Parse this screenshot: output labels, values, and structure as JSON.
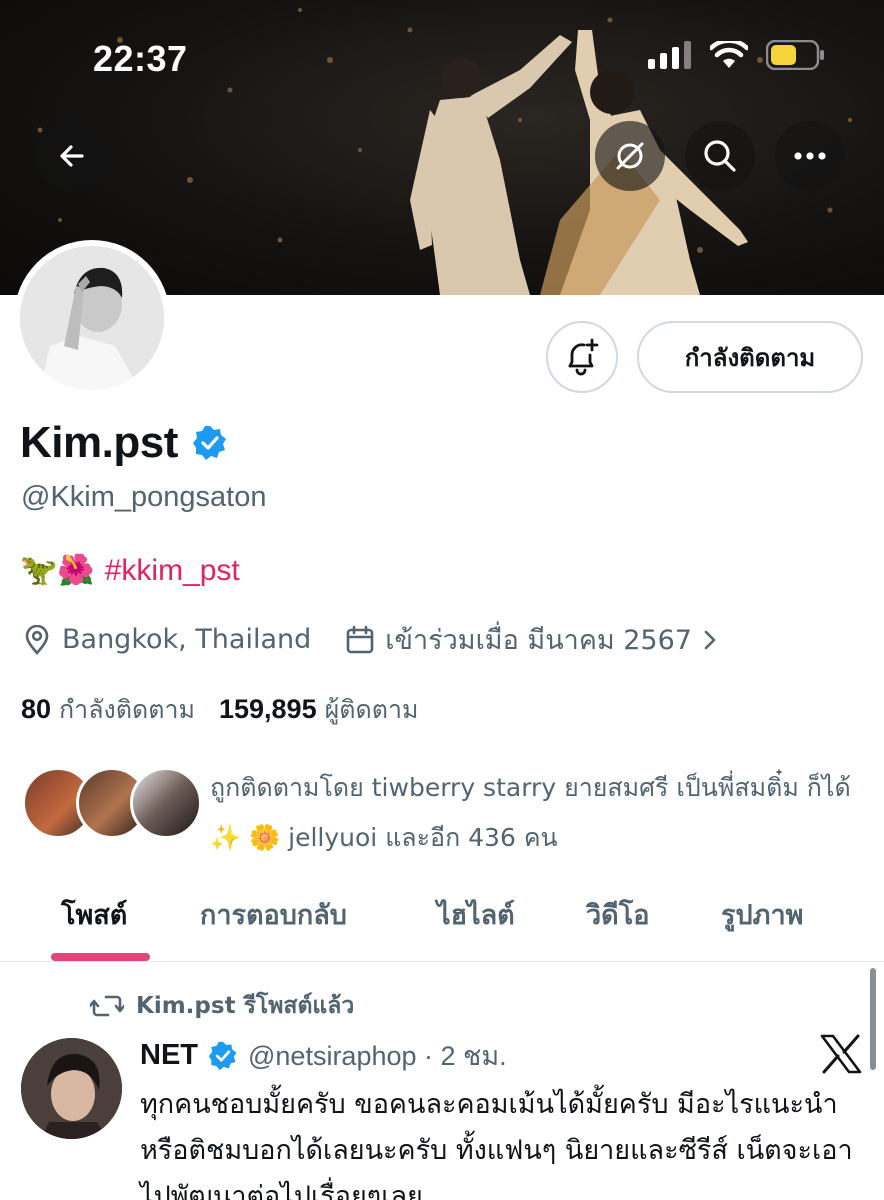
{
  "status_bar": {
    "time": "22:37"
  },
  "icons": {
    "back": "back-arrow-icon",
    "translate": "translate-off-icon",
    "search": "search-icon",
    "more": "more-icon",
    "bell": "notification-add-icon",
    "location": "location-pin-icon",
    "calendar": "calendar-icon",
    "verified": "verified-badge-icon",
    "repost": "repost-icon",
    "x_logo": "x-logo-icon"
  },
  "colors": {
    "accent": "#e0457b",
    "hashtag": "#e0245e",
    "verified": "#1d9bf0",
    "muted": "#536471"
  },
  "profile": {
    "name": "Kim.pst",
    "handle": "@Kkim_pongsaton",
    "bio_emoji": "🦖🌺",
    "bio_hashtag": "#kkim_pst",
    "location": "Bangkok, Thailand",
    "joined": "เข้าร่วมเมื่อ มีนาคม 2567",
    "follow_button": "กำลังติดตาม",
    "following_count": "80",
    "following_label": "กำลังติดตาม",
    "followers_count": "159,895",
    "followers_label": "ผู้ติดตาม",
    "followed_by": "ถูกติดตามโดย tiwberry starry ยายสมศรี เป็นพี่สมติ๋ม ก็ได้ ✨ 🌼 jellyuoi และอีก 436 คน"
  },
  "tabs": [
    "โพสต์",
    "การตอบกลับ",
    "ไฮไลต์",
    "วิดีโอ",
    "รูปภาพ"
  ],
  "post": {
    "repost_label": "Kim.pst รีโพสต์แล้ว",
    "author_name": "NET",
    "author_meta": "@netsiraphop · 2 ชม.",
    "text": "ทุกคนชอบมั้ยครับ ขอคนละคอมเม้นได้มั้ยครับ มีอะไรแนะนำหรือติชมบอกได้เลยนะครับ ทั้งแฟนๆ นิยายและซีรีส์ เน็ตจะเอาไปพัฒนาต่อไปเรื่อยๆเลย"
  }
}
